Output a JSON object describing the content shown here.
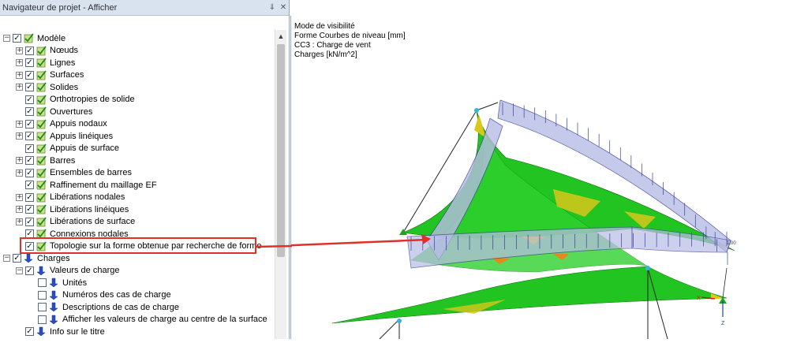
{
  "navigator": {
    "title": "Navigateur de projet - Afficher",
    "pin_icon": "pin-icon",
    "close_icon": "close-icon"
  },
  "tree": [
    {
      "label": "Modèle",
      "level": 0,
      "expand": "-",
      "checked": true,
      "icon": "model-check-icon"
    },
    {
      "label": "Nœuds",
      "level": 1,
      "expand": "+",
      "checked": true,
      "icon": "model-check-icon"
    },
    {
      "label": "Lignes",
      "level": 1,
      "expand": "+",
      "checked": true,
      "icon": "model-check-icon"
    },
    {
      "label": "Surfaces",
      "level": 1,
      "expand": "+",
      "checked": true,
      "icon": "model-check-icon"
    },
    {
      "label": "Solides",
      "level": 1,
      "expand": "+",
      "checked": true,
      "icon": "model-check-icon"
    },
    {
      "label": "Orthotropies de solide",
      "level": 1,
      "expand": "",
      "checked": true,
      "icon": "model-check-icon"
    },
    {
      "label": "Ouvertures",
      "level": 1,
      "expand": "",
      "checked": true,
      "icon": "model-check-icon"
    },
    {
      "label": "Appuis nodaux",
      "level": 1,
      "expand": "+",
      "checked": true,
      "icon": "model-check-icon"
    },
    {
      "label": "Appuis linéiques",
      "level": 1,
      "expand": "+",
      "checked": true,
      "icon": "model-check-icon"
    },
    {
      "label": "Appuis de surface",
      "level": 1,
      "expand": "",
      "checked": true,
      "icon": "model-check-icon"
    },
    {
      "label": "Barres",
      "level": 1,
      "expand": "+",
      "checked": true,
      "icon": "model-check-icon"
    },
    {
      "label": "Ensembles de barres",
      "level": 1,
      "expand": "+",
      "checked": true,
      "icon": "model-check-icon"
    },
    {
      "label": "Raffinement du maillage EF",
      "level": 1,
      "expand": "",
      "checked": true,
      "icon": "model-check-icon"
    },
    {
      "label": "Libérations nodales",
      "level": 1,
      "expand": "+",
      "checked": true,
      "icon": "model-check-icon"
    },
    {
      "label": "Libérations linéiques",
      "level": 1,
      "expand": "+",
      "checked": true,
      "icon": "model-check-icon"
    },
    {
      "label": "Libérations de surface",
      "level": 1,
      "expand": "+",
      "checked": true,
      "icon": "model-check-icon"
    },
    {
      "label": "Connexions nodales",
      "level": 1,
      "expand": "",
      "checked": true,
      "icon": "model-check-icon"
    },
    {
      "label": "Topologie sur la forme obtenue par recherche de forme",
      "level": 1,
      "expand": "",
      "checked": true,
      "icon": "model-check-icon"
    },
    {
      "label": "Charges",
      "level": 0,
      "expand": "-",
      "checked": true,
      "icon": "load-arrow-icon"
    },
    {
      "label": "Valeurs de charge",
      "level": 1,
      "expand": "-",
      "checked": true,
      "icon": "load-arrow-icon"
    },
    {
      "label": "Unités",
      "level": 2,
      "expand": "",
      "checked": false,
      "icon": "load-arrow-icon"
    },
    {
      "label": "Numéros des cas de charge",
      "level": 2,
      "expand": "",
      "checked": false,
      "icon": "load-arrow-icon"
    },
    {
      "label": "Descriptions de cas de charge",
      "level": 2,
      "expand": "",
      "checked": false,
      "icon": "load-arrow-icon"
    },
    {
      "label": "Afficher les valeurs de charge au centre de la surface",
      "level": 2,
      "expand": "",
      "checked": false,
      "icon": "load-arrow-icon"
    },
    {
      "label": "Info sur le titre",
      "level": 1,
      "expand": "",
      "checked": true,
      "icon": "load-arrow-icon"
    }
  ],
  "view_info": {
    "line1": "Mode de visibilité",
    "line2": "Forme Courbes de niveau [mm]",
    "line3": "CC3 : Charge de vent",
    "line4": "Charges [kN/m^2]"
  },
  "model_view": {
    "load_value_label": "1.00",
    "axis_x": "X",
    "axis_z": "Z"
  },
  "colors": {
    "surface_green": "#22c422",
    "contour_yellow": "#d8c81a",
    "contour_orange": "#e38a1a",
    "load_fill": "#b8bde6",
    "load_stroke": "#3a3f9a",
    "annotation_red": "#e0302b"
  }
}
